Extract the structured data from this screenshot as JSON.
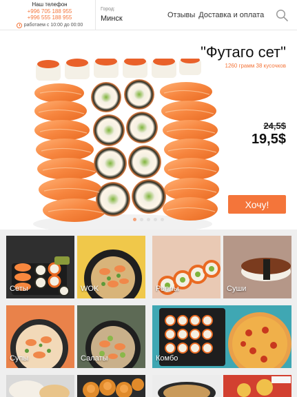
{
  "header": {
    "phone_title": "Наш телефон",
    "phones": [
      "+996 705 188 955",
      "+996 555 188 955"
    ],
    "hours": "работаем с 10:00 до 00:00",
    "city_label": "Город:",
    "city_value": "Минск",
    "nav": [
      "Отзывы",
      "Доставка и оплата"
    ]
  },
  "hero": {
    "title": "\"Футаго сет\"",
    "subtitle": "1260 грамм 38 кусочков",
    "old_price": "24,5$",
    "new_price": "19,5$",
    "button": "Хочу!",
    "slides": 5,
    "active_slide": 1
  },
  "categories": [
    {
      "label": "Сеты"
    },
    {
      "label": "WOK"
    },
    {
      "label": "Роллы"
    },
    {
      "label": "Суши"
    },
    {
      "label": "Супы"
    },
    {
      "label": "Салаты"
    },
    {
      "label": "Комбо"
    },
    {
      "label": ""
    },
    {
      "label": ""
    },
    {
      "label": ""
    },
    {
      "label": ""
    }
  ],
  "colors": {
    "accent": "#f4753a"
  }
}
